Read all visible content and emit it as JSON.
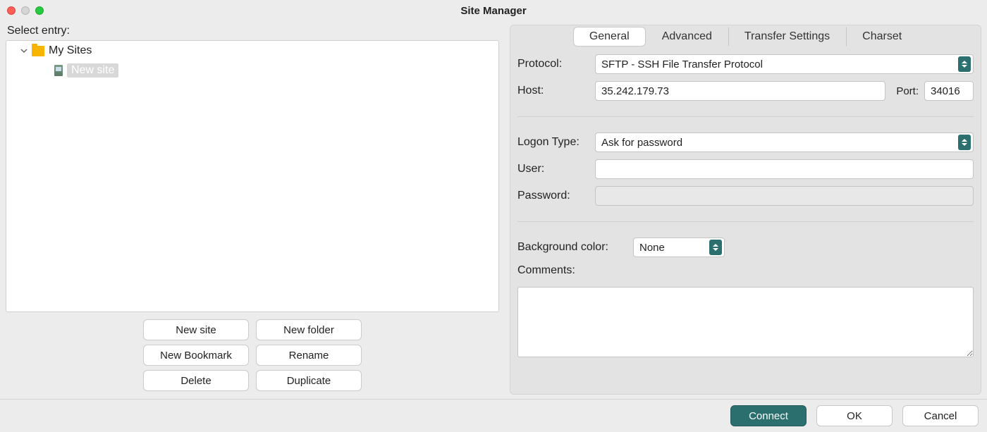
{
  "window": {
    "title": "Site Manager"
  },
  "left": {
    "select_label": "Select entry:",
    "tree": {
      "root_label": "My Sites",
      "site_label": "New site"
    },
    "buttons": {
      "new_site": "New site",
      "new_folder": "New folder",
      "new_bookmark": "New Bookmark",
      "rename": "Rename",
      "delete": "Delete",
      "duplicate": "Duplicate"
    }
  },
  "tabs": {
    "general": "General",
    "advanced": "Advanced",
    "transfer": "Transfer Settings",
    "charset": "Charset"
  },
  "form": {
    "protocol_label": "Protocol:",
    "protocol_value": "SFTP - SSH File Transfer Protocol",
    "host_label": "Host:",
    "host_value": "35.242.179.73",
    "port_label": "Port:",
    "port_value": "34016",
    "logon_label": "Logon Type:",
    "logon_value": "Ask for password",
    "user_label": "User:",
    "user_value": "",
    "password_label": "Password:",
    "password_value": "",
    "bgcolor_label": "Background color:",
    "bgcolor_value": "None",
    "comments_label": "Comments:",
    "comments_value": ""
  },
  "footer": {
    "connect": "Connect",
    "ok": "OK",
    "cancel": "Cancel"
  }
}
